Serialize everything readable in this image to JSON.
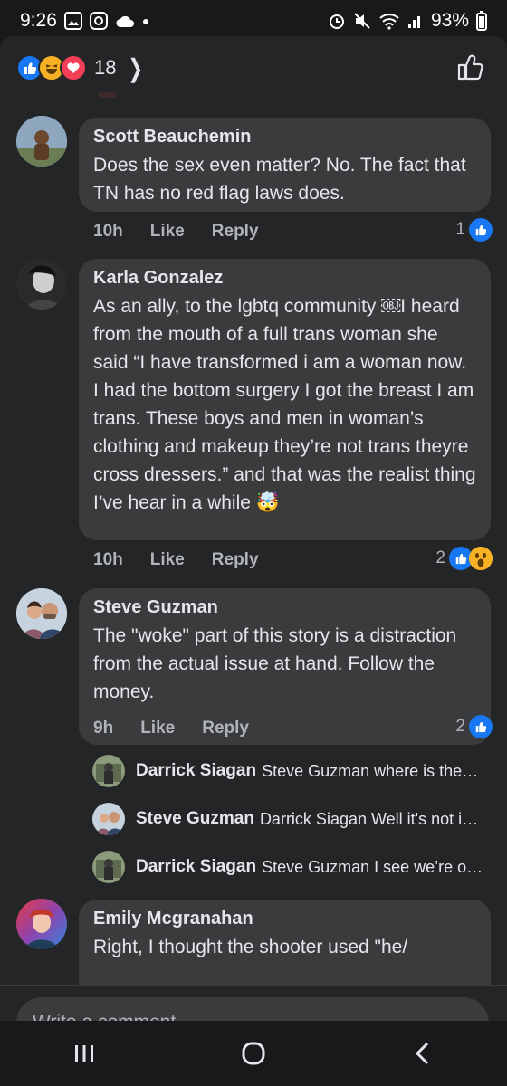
{
  "status_bar": {
    "time": "9:26",
    "battery": "93%"
  },
  "reactions_header": {
    "count": "18"
  },
  "comments": [
    {
      "author": "Scott Beauchemin",
      "text": "Does the sex even matter? No. The fact that TN has no red flag laws does.",
      "time": "10h",
      "like_label": "Like",
      "reply_label": "Reply",
      "reaction_count": "1"
    },
    {
      "author": "Karla Gonzalez",
      "text": "As an ally, to the lgbtq community ￼I heard from the mouth of a full trans woman she said “I have transformed i am a woman now. I had the bottom surgery I got the breast I am trans. These boys and men in woman’s clothing and makeup they’re not trans theyre cross dressers.” and that was the realist thing I’ve hear in a while 🤯",
      "time": "10h",
      "like_label": "Like",
      "reply_label": "Reply",
      "reaction_count": "2"
    },
    {
      "author": "Steve Guzman",
      "text": "The \"woke\" part of this story is a distraction from the actual issue at hand. Follow the money.",
      "time": "9h",
      "like_label": "Like",
      "reply_label": "Reply",
      "reaction_count": "2"
    },
    {
      "author": "Emily Mcgranahan",
      "text": "Right, I thought the shooter used \"he/"
    }
  ],
  "replies": [
    {
      "author": "Darrick Siagan",
      "text": "Steve Guzman where is the…"
    },
    {
      "author": "Steve Guzman",
      "text": "Darrick Siagan Well it's not i…"
    },
    {
      "author": "Darrick Siagan",
      "text": "Steve Guzman I see we’re o…"
    }
  ],
  "composer": {
    "placeholder": "Write a comment…"
  },
  "colors": {
    "background": "#242526",
    "bubble": "#3a3b3c",
    "like_blue": "#1877f2",
    "secondary_text": "#b0b3b8"
  }
}
